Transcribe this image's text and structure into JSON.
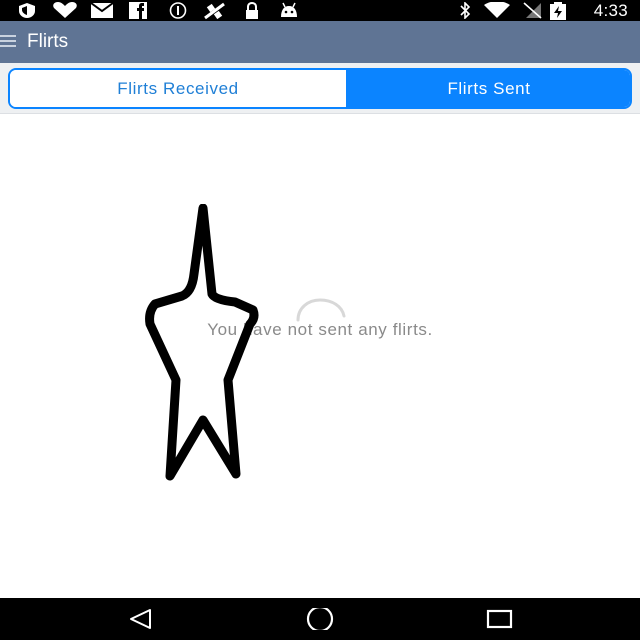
{
  "status_bar": {
    "time": "4:33",
    "left_icons": [
      "shield-icon",
      "heart-icon",
      "mail-icon",
      "facebook-icon",
      "info-icon",
      "satellite-icon",
      "lock-icon",
      "android-icon"
    ],
    "right_icons": [
      "bluetooth-icon",
      "wifi-icon",
      "no-signal-icon",
      "battery-charging-icon"
    ]
  },
  "app_bar": {
    "title": "Flirts",
    "menu_icon": "hamburger-icon",
    "color": "#5f7494"
  },
  "tabs": {
    "received_label": "Flirts Received",
    "sent_label": "Flirts Sent",
    "selected": "Flirts Sent",
    "accent": "#0b84ff"
  },
  "content": {
    "empty_message": "You have not sent any flirts.",
    "loading": true
  },
  "nav_bar": {
    "buttons": [
      "back-icon",
      "home-icon",
      "recents-icon"
    ]
  }
}
